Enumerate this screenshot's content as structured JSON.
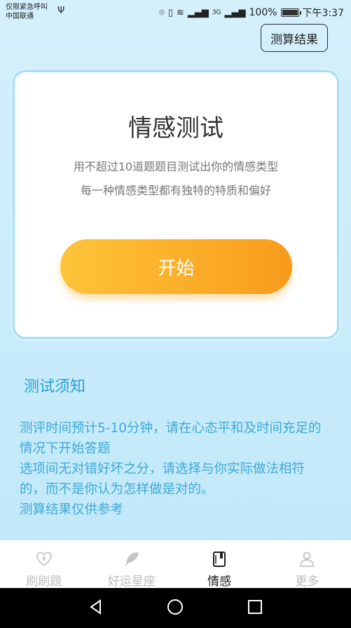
{
  "status_bar": {
    "carrier_line1": "仅限紧急呼叫",
    "carrier_line2": "中国联通",
    "network": "3G",
    "battery": "100%",
    "time": "下午3:37"
  },
  "header": {
    "result_button": "测算结果"
  },
  "card": {
    "title": "情感测试",
    "desc_line1": "用不超过10道题题目测试出你的情感类型",
    "desc_line2": "每一种情感类型都有独特的特质和偏好",
    "start_button": "开始"
  },
  "notice": {
    "title": "测试须知",
    "lines": [
      "测评时间预计5-10分钟，请在心态平和及时间充足的情况下开始答题",
      "选项间无对错好坏之分，请选择与你实际做法相符的，而不是你认为怎样做是对的。",
      "测算结果仅供参考"
    ]
  },
  "tabs": [
    {
      "label": "刷刷题",
      "icon": "heart-plus-icon",
      "active": false
    },
    {
      "label": "好运星座",
      "icon": "feather-icon",
      "active": false
    },
    {
      "label": "情感",
      "icon": "notebook-icon",
      "active": true
    },
    {
      "label": "更多",
      "icon": "user-icon",
      "active": false
    }
  ],
  "colors": {
    "accent": "#2a9fd3",
    "button_orange": "#fbb02c",
    "background": "#c9ecfa"
  }
}
